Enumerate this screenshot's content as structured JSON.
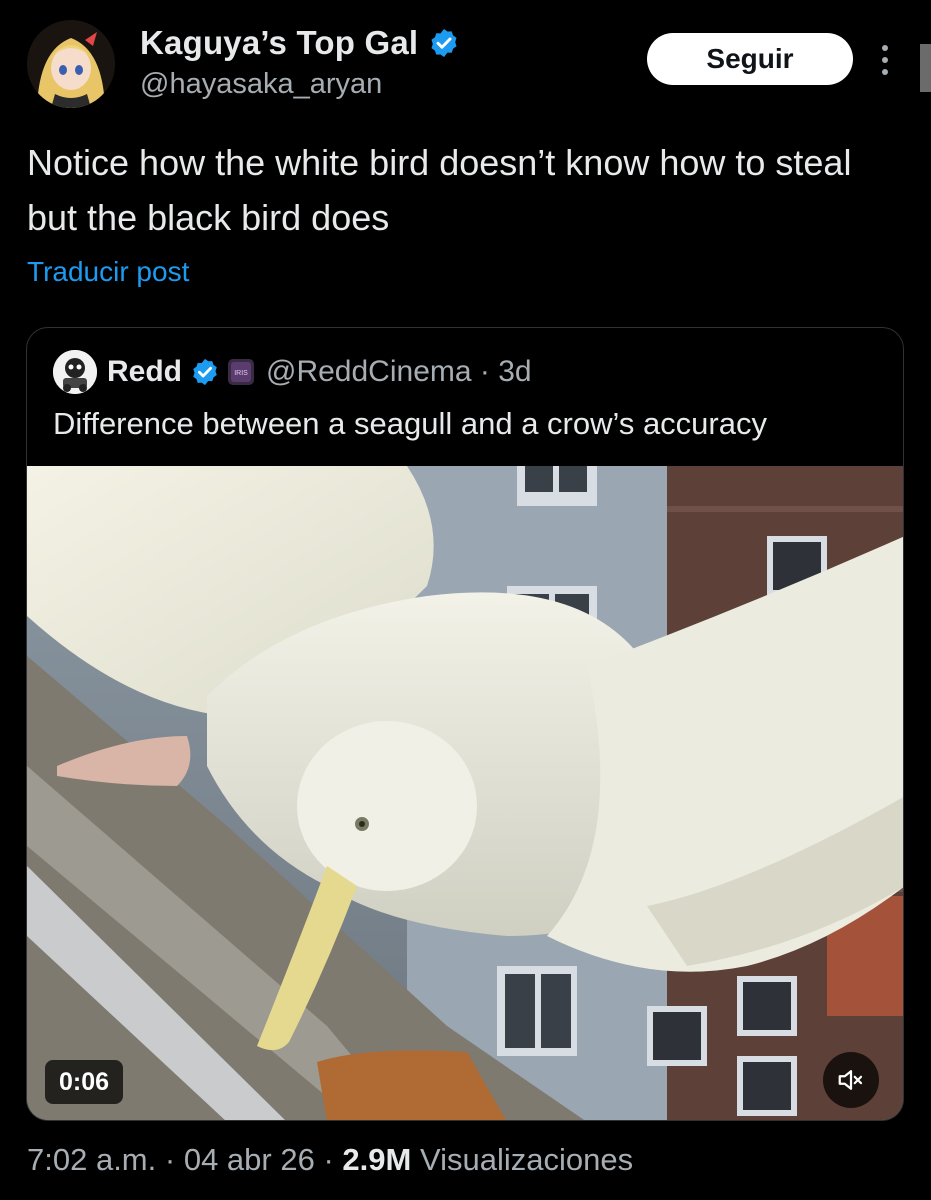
{
  "author": {
    "display_name": "Kaguya’s Top Gal",
    "handle": "@hayasaka_aryan",
    "verified": true
  },
  "actions": {
    "follow_label": "Seguir"
  },
  "post": {
    "text": "Notice how the white bird doesn’t know how to steal but the black bird does",
    "translate_label": "Traducir post"
  },
  "quoted_post": {
    "display_name": "Redd",
    "handle": "@ReddCinema",
    "separator": "·",
    "age": "3d",
    "text": "Difference between a seagull and a crow’s accuracy",
    "badge_text": "IRIS",
    "video": {
      "duration": "0:06",
      "muted": true
    }
  },
  "meta": {
    "time": "7:02 a.m.",
    "sep1": "·",
    "date": "04 abr 26",
    "sep2": "·",
    "views_count": "2.9M",
    "views_label": "Visualizaciones"
  },
  "colors": {
    "background": "#000000",
    "link_blue": "#1d9bf0",
    "verified_blue": "#1d9bf0",
    "secondary_text": "#a6adb3"
  }
}
